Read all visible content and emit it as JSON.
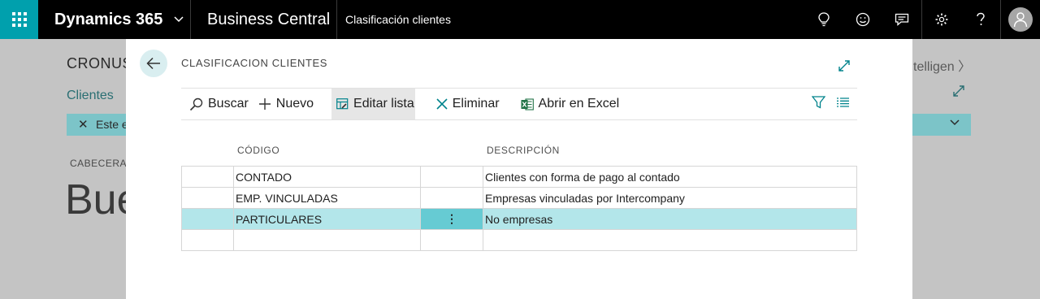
{
  "topbar": {
    "brand": "Dynamics 365",
    "product": "Business Central",
    "page_title": "Clasificación clientes"
  },
  "background": {
    "company": "CRONUS",
    "breadcrumb": "Clientes",
    "filter_text": "Este e",
    "section": "CABECERA",
    "big_text": "Bue",
    "right_text": "telligen"
  },
  "dialog": {
    "title": "CLASIFICACION CLIENTES",
    "actions": {
      "search": "Buscar",
      "new": "Nuevo",
      "edit_list": "Editar lista",
      "delete": "Eliminar",
      "excel": "Abrir en Excel"
    },
    "columns": {
      "code": "CÓDIGO",
      "description": "DESCRIPCIÓN"
    },
    "rows": [
      {
        "code": "CONTADO",
        "description": "Clientes con forma de pago al contado",
        "actions": ""
      },
      {
        "code": "EMP. VINCULADAS",
        "description": "Empresas vinculadas por Intercompany",
        "actions": ""
      },
      {
        "code": "PARTICULARES",
        "description": "No empresas",
        "actions": "⋮"
      },
      {
        "code": "",
        "description": "",
        "actions": ""
      }
    ]
  },
  "colors": {
    "accent": "#00a0ad",
    "selected_row": "#b3e6ea",
    "selected_cell": "#66cbd3"
  }
}
